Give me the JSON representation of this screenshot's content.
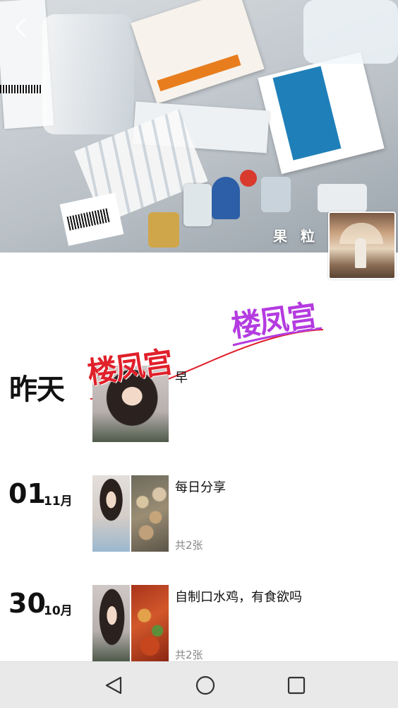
{
  "cover": {
    "name": "果 粒",
    "colors": {
      "name_text": "#ffffff"
    }
  },
  "watermarks": [
    {
      "text": "楼凤宫",
      "color": "#b43be0"
    },
    {
      "text": "楼凤宫",
      "color": "#e0202a"
    }
  ],
  "timeline": [
    {
      "date_big": "昨天",
      "text": "早",
      "photo_count": ""
    },
    {
      "day": "01",
      "month": "11月",
      "text": "每日分享",
      "photo_count": "共2张"
    },
    {
      "day": "30",
      "month": "10月",
      "text": "自制口水鸡，有食欲吗",
      "photo_count": "共2张"
    }
  ],
  "icons": {
    "back": "chevron-left-icon",
    "nav_back": "triangle-back-icon",
    "nav_home": "circle-home-icon",
    "nav_recent": "square-recent-icon"
  }
}
